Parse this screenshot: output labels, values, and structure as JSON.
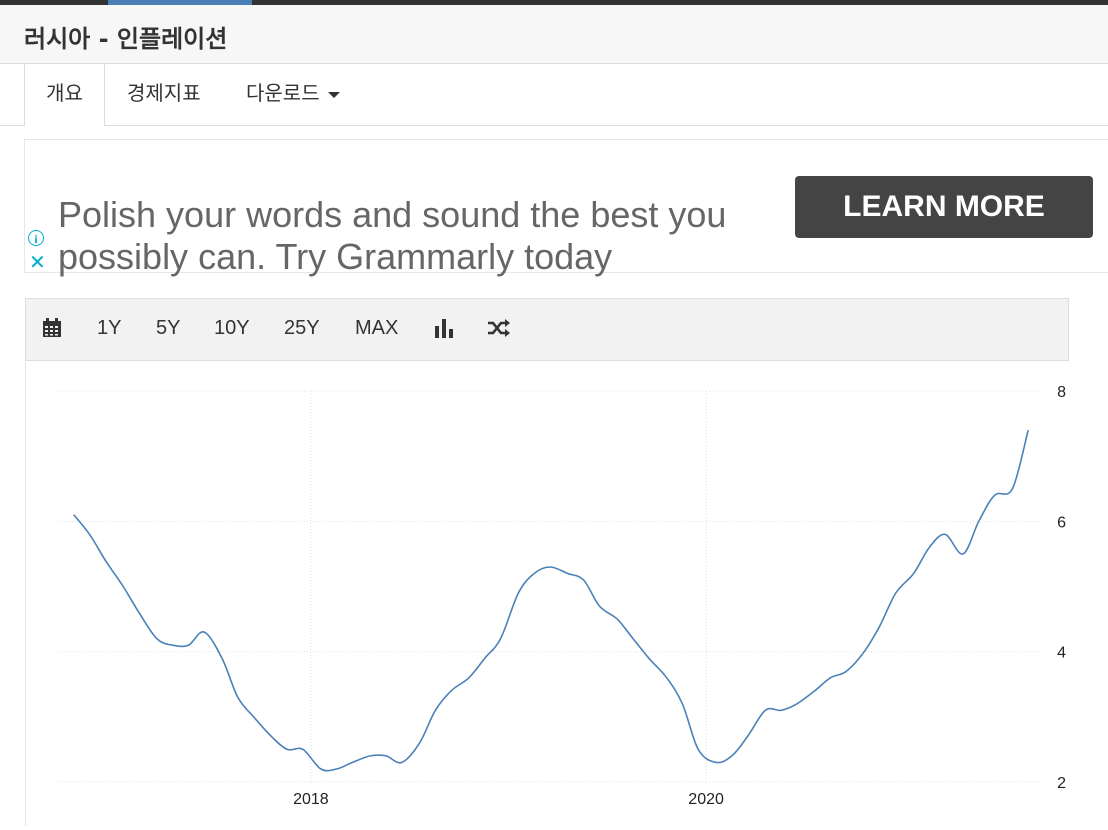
{
  "header": {
    "title": "러시아 - 인플레이션"
  },
  "tabs": [
    {
      "label": "개요",
      "active": true
    },
    {
      "label": "경제지표"
    },
    {
      "label": "다운로드"
    }
  ],
  "ad": {
    "text": "Polish your words and sound the best you possibly can. Try Grammarly today",
    "button_label": "LEARN MORE",
    "info_icon": "info-icon",
    "close_icon": "close-icon"
  },
  "toolbar": {
    "calendar_icon": "calendar-icon",
    "ranges": [
      "1Y",
      "5Y",
      "10Y",
      "25Y",
      "MAX"
    ],
    "chart_type_icon": "bar-chart-icon",
    "compare_icon": "shuffle-icon"
  },
  "colors": {
    "line": "#4a81b8",
    "grid": "#e0e0e0"
  },
  "chart_data": {
    "type": "line",
    "title": "",
    "xlabel": "",
    "ylabel": "",
    "xlim": [
      2016.72,
      2021.7
    ],
    "ylim": [
      2,
      8
    ],
    "x_ticks": [
      2018,
      2020
    ],
    "x_tick_labels": [
      "2018",
      "2020"
    ],
    "y_ticks": [
      2,
      4,
      6,
      8
    ],
    "y_tick_labels": [
      "2",
      "4",
      "6",
      "8"
    ],
    "grid": true,
    "series": [
      {
        "x": [
          2016.8,
          2016.88,
          2016.96,
          2017.05,
          2017.13,
          2017.22,
          2017.3,
          2017.38,
          2017.46,
          2017.55,
          2017.63,
          2017.71,
          2017.8,
          2017.88,
          2017.96,
          2018.05,
          2018.13,
          2018.21,
          2018.3,
          2018.38,
          2018.46,
          2018.55,
          2018.63,
          2018.71,
          2018.8,
          2018.88,
          2018.96,
          2019.05,
          2019.13,
          2019.21,
          2019.3,
          2019.38,
          2019.46,
          2019.55,
          2019.63,
          2019.71,
          2019.8,
          2019.88,
          2019.96,
          2020.05,
          2020.13,
          2020.21,
          2020.3,
          2020.38,
          2020.46,
          2020.55,
          2020.63,
          2020.71,
          2020.8,
          2020.88,
          2020.96,
          2021.05,
          2021.13,
          2021.21,
          2021.3,
          2021.38,
          2021.46,
          2021.55,
          2021.63
        ],
        "y": [
          6.1,
          5.8,
          5.4,
          5.0,
          4.6,
          4.2,
          4.1,
          4.1,
          4.3,
          3.9,
          3.3,
          3.0,
          2.7,
          2.5,
          2.5,
          2.2,
          2.2,
          2.3,
          2.4,
          2.4,
          2.3,
          2.6,
          3.1,
          3.4,
          3.6,
          3.9,
          4.2,
          4.9,
          5.2,
          5.3,
          5.2,
          5.1,
          4.7,
          4.5,
          4.2,
          3.9,
          3.6,
          3.2,
          2.5,
          2.3,
          2.4,
          2.7,
          3.1,
          3.1,
          3.2,
          3.4,
          3.6,
          3.7,
          4.0,
          4.4,
          4.9,
          5.2,
          5.6,
          5.8,
          5.5,
          6.0,
          6.4,
          6.5,
          7.4
        ]
      }
    ]
  }
}
